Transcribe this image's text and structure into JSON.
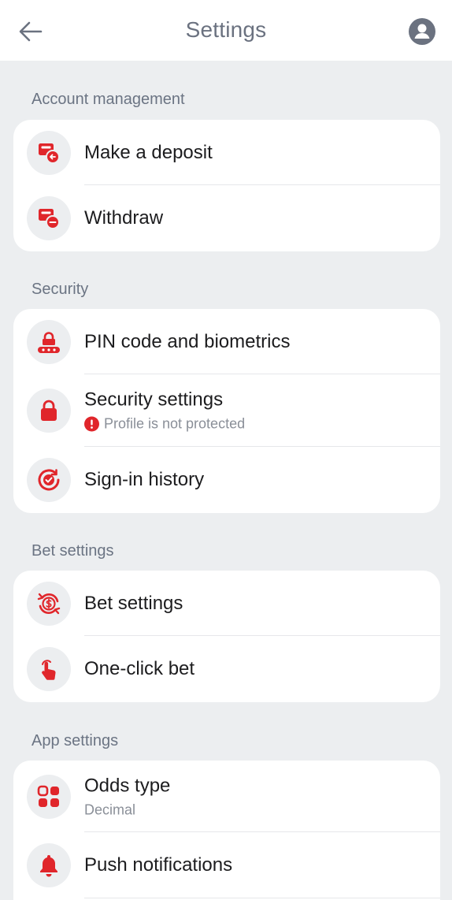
{
  "header": {
    "title": "Settings",
    "back_icon": "arrow-left-icon",
    "profile_icon": "user-avatar-icon"
  },
  "colors": {
    "accent": "#E0262B",
    "background": "#ECEEF0",
    "card": "#FFFFFF",
    "muted_text": "#6B7483"
  },
  "sections": [
    {
      "title": "Account management",
      "items": [
        {
          "label": "Make a deposit",
          "icon": "deposit-icon"
        },
        {
          "label": "Withdraw",
          "icon": "withdraw-icon"
        }
      ]
    },
    {
      "title": "Security",
      "items": [
        {
          "label": "PIN code and biometrics",
          "icon": "pin-lock-icon"
        },
        {
          "label": "Security settings",
          "icon": "lock-icon",
          "sublabel": "Profile is not protected",
          "sub_icon": "warning-icon"
        },
        {
          "label": "Sign-in history",
          "icon": "sign-in-history-icon"
        }
      ]
    },
    {
      "title": "Bet settings",
      "items": [
        {
          "label": "Bet settings",
          "icon": "bet-settings-icon"
        },
        {
          "label": "One-click bet",
          "icon": "tap-finger-icon"
        }
      ]
    },
    {
      "title": "App settings",
      "items": [
        {
          "label": "Odds type",
          "icon": "grid-icon",
          "sublabel": "Decimal"
        },
        {
          "label": "Push notifications",
          "icon": "bell-icon"
        }
      ]
    }
  ]
}
